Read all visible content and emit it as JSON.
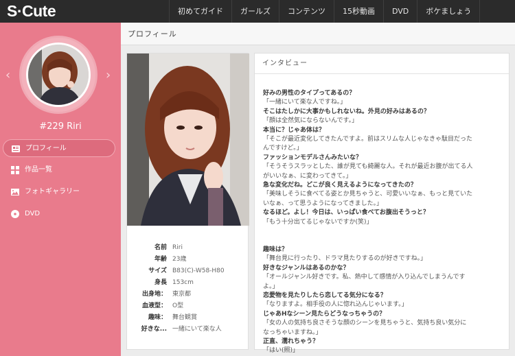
{
  "header": {
    "logo": "S·Cute",
    "nav": [
      "初めてガイド",
      "ガールズ",
      "コンテンツ",
      "15秒動画",
      "DVD",
      "ボケましょう"
    ]
  },
  "sidebar": {
    "girl_name": "#229 Riri",
    "menu": [
      {
        "label": "プロフィール",
        "icon": "grid-card-icon",
        "active": true
      },
      {
        "label": "作品一覧",
        "icon": "tiles-icon",
        "active": false
      },
      {
        "label": "フォトギャラリー",
        "icon": "photo-icon",
        "active": false
      },
      {
        "label": "DVD",
        "icon": "disc-icon",
        "active": false
      }
    ]
  },
  "page": {
    "title": "プロフィール"
  },
  "profile": {
    "rows": [
      {
        "label": "名前",
        "value": "Riri"
      },
      {
        "label": "年齢",
        "value": "23歳"
      },
      {
        "label": "サイズ",
        "value": "B83(C)-W58-H80"
      },
      {
        "label": "身長",
        "value": "153cm"
      },
      {
        "label": "出身地：",
        "value": "東京都"
      },
      {
        "label": "血液型：",
        "value": "O型"
      },
      {
        "label": "趣味：",
        "value": "舞台観賞"
      },
      {
        "label": "好きな...",
        "value": "一緒にいて楽な人"
      }
    ]
  },
  "interview": {
    "title": "インタビュー",
    "lines": [
      {
        "t": "q",
        "text": "好みの男性のタイプってあるの？"
      },
      {
        "t": "a",
        "text": "「一緒にいて楽な人ですね。」"
      },
      {
        "t": "q",
        "text": "そこはたしかに大事かもしれないね。外見の好みはあるの？"
      },
      {
        "t": "a",
        "text": "「顔は全然気にならないんです。」"
      },
      {
        "t": "q",
        "text": "本当に？じゃあ体は？"
      },
      {
        "t": "a",
        "text": "「そこが最近変化してきたんですよ。前はスリムな人じゃなきゃ駄目だった"
      },
      {
        "t": "a",
        "text": "んですけど。」"
      },
      {
        "t": "q",
        "text": "ファッションモデルさんみたいな？"
      },
      {
        "t": "a",
        "text": "「そうそうスラッとした、誰が見ても綺麗な人。それが最近お腹が出てる人"
      },
      {
        "t": "a",
        "text": "がいいなぁ、に変わってきて。」"
      },
      {
        "t": "q",
        "text": "急な変化だね。どこが良く見えるようになってきたの？"
      },
      {
        "t": "a",
        "text": "「美味しそうに食べてる姿とか見ちゃうと、可愛いいなぁ、もっと見ていた"
      },
      {
        "t": "a",
        "text": "いなぁ、って思うようになってきました。」"
      },
      {
        "t": "q",
        "text": "なるほど。よし！今日は、いっぱい食べてお腹出そうっと？"
      },
      {
        "t": "a",
        "text": "「もう十分出てるじゃないですか(笑)」"
      },
      {
        "t": "gap",
        "text": ""
      },
      {
        "t": "gap",
        "text": ""
      },
      {
        "t": "q",
        "text": "趣味は？"
      },
      {
        "t": "a",
        "text": "「舞台見に行ったり、ドラマ見たりするのが好きですね。」"
      },
      {
        "t": "q",
        "text": "好きなジャンルはあるのかな？"
      },
      {
        "t": "a",
        "text": "「オールジャンル好きです。私、熱中して感情が入り込んでしまうんです"
      },
      {
        "t": "a",
        "text": "よ。」"
      },
      {
        "t": "q",
        "text": "恋愛物を見たりしたら恋してる気分になる？"
      },
      {
        "t": "a",
        "text": "「なりますよ。相手役の人に惚れ込んじゃいます。」"
      },
      {
        "t": "q",
        "text": "じゃあHなシーン見たらどうなっちゃうの？"
      },
      {
        "t": "a",
        "text": "「女の人の気持ち良さそうな顔のシーンを見ちゃうと、気持ち良い気分に"
      },
      {
        "t": "a",
        "text": "なっちゃいますね。」"
      },
      {
        "t": "q",
        "text": "正直、濡れちゃう？"
      },
      {
        "t": "a",
        "text": "「はい(照)」"
      }
    ]
  },
  "colors": {
    "topbar": "#2b2b2b",
    "sidebar": "#e97b8c",
    "sidebar_active": "#dd6b7d"
  }
}
